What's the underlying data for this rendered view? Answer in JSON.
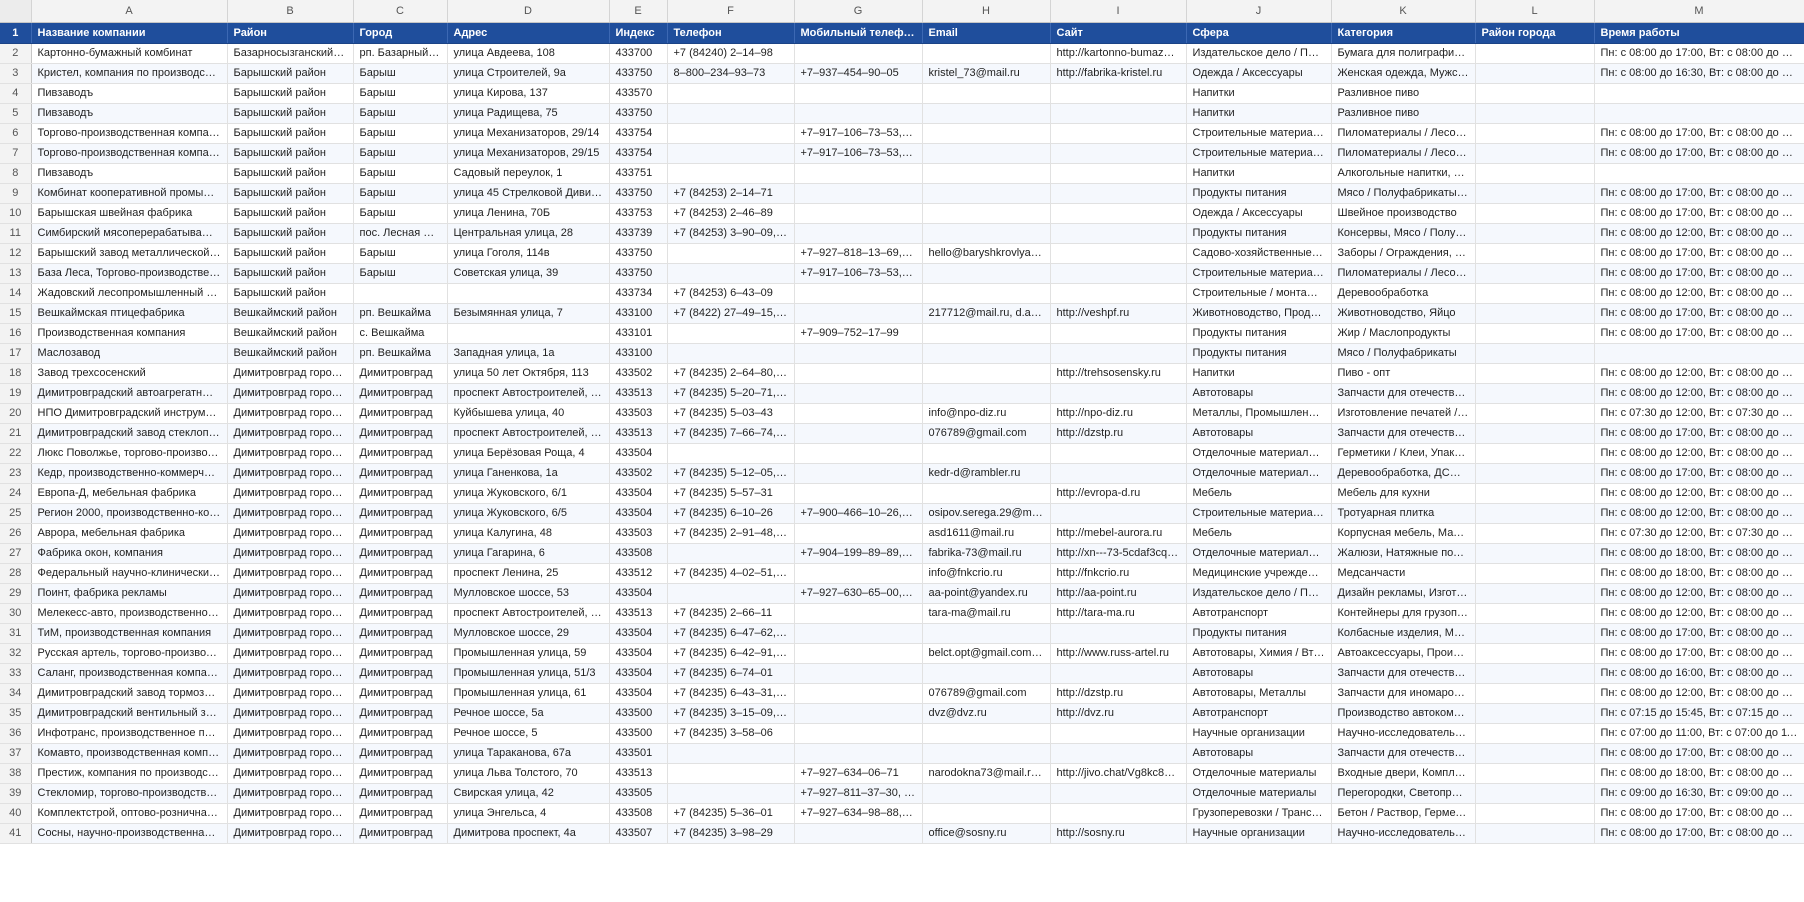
{
  "column_letters": [
    "A",
    "B",
    "C",
    "D",
    "E",
    "F",
    "G",
    "H",
    "I",
    "J",
    "K",
    "L",
    "M"
  ],
  "header": {
    "row_number": "1",
    "cells": [
      "Название компании",
      "Район",
      "Город",
      "Адрес",
      "Индекс",
      "Телефон",
      "Мобильный телефон",
      "Email",
      "Сайт",
      "Сфера",
      "Категория",
      "Район города",
      "Время работы"
    ]
  },
  "rows": [
    {
      "num": "2",
      "cells": [
        "Картонно-бумажный комбинат",
        "Базарносызганский ра...",
        "рп. Базарный С...",
        "улица Авдеева, 108",
        "433700",
        "+7 (84240) 2–14–98",
        "",
        "",
        "http://kartonno-bumazhn...",
        "Издательское дело / Поли...",
        "Бумага для полиграфии, Б...",
        "",
        "Пн: с 08:00 до 17:00, Вт: с 08:00 до 17:00, С..."
      ]
    },
    {
      "num": "3",
      "cells": [
        "Кристел, компания по производству ...",
        "Барышский район",
        "Барыш",
        "улица Строителей, 9а",
        "433750",
        "8–800–234–93–73",
        "+7–937–454–90–05",
        "kristel_73@mail.ru",
        "http://fabrika-kristel.ru",
        "Одежда / Аксессуары",
        "Женская одежда, Мужская...",
        "",
        "Пн: с 08:00 до 16:30, Вт: с 08:00 до 16:30, С..."
      ]
    },
    {
      "num": "4",
      "cells": [
        "Пивзаводъ",
        "Барышский район",
        "Барыш",
        "улица Кирова, 137",
        "433570",
        "",
        "",
        "",
        "",
        "Напитки",
        "Разливное пиво",
        "",
        ""
      ]
    },
    {
      "num": "5",
      "cells": [
        "Пивзаводъ",
        "Барышский район",
        "Барыш",
        "улица Радищева, 75",
        "433750",
        "",
        "",
        "",
        "",
        "Напитки",
        "Разливное пиво",
        "",
        ""
      ]
    },
    {
      "num": "6",
      "cells": [
        "Торгово-производственная компания",
        "Барышский район",
        "Барыш",
        "улица Механизаторов, 29/14",
        "433754",
        "",
        "+7–917–106–73–53, +7...",
        "",
        "",
        "Строительные материалы ...",
        "Пиломатериалы / Лесомат...",
        "",
        "Пн: с 08:00 до 17:00, Вт: с 08:00 до 17:00, С..."
      ]
    },
    {
      "num": "7",
      "cells": [
        "Торгово-производственная компания",
        "Барышский район",
        "Барыш",
        "улица Механизаторов, 29/15",
        "433754",
        "",
        "+7–917–106–73–53, +7...",
        "",
        "",
        "Строительные материалы ...",
        "Пиломатериалы / Лесомат...",
        "",
        "Пн: с 08:00 до 17:00, Вт: с 08:00 до 17:00, С..."
      ]
    },
    {
      "num": "8",
      "cells": [
        "Пивзаводъ",
        "Барышский район",
        "Барыш",
        "Садовый переулок, 1",
        "433751",
        "",
        "",
        "",
        "",
        "Напитки",
        "Алкогольные напитки, Раз...",
        "",
        ""
      ]
    },
    {
      "num": "9",
      "cells": [
        "Комбинат кооперативной промышле...",
        "Барышский район",
        "Барыш",
        "улица 45 Стрелковой Дивизии...",
        "433750",
        "+7 (84253) 2–14–71",
        "",
        "",
        "",
        "Продукты питания",
        "Мясо / Полуфабрикаты, Хл...",
        "",
        "Пн: с 08:00 до 17:00, Вт: с 08:00 до 17:00, С..."
      ]
    },
    {
      "num": "10",
      "cells": [
        "Барышская швейная фабрика",
        "Барышский район",
        "Барыш",
        "улица Ленина, 70Б",
        "433753",
        "+7 (84253) 2–46–89",
        "",
        "",
        "",
        "Одежда / Аксессуары",
        "Швейное производство",
        "",
        "Пн: с 08:00 до 17:00, Вт: с 08:00 до 17:00, С..."
      ]
    },
    {
      "num": "11",
      "cells": [
        "Симбирский мясоперерабатывающи...",
        "Барышский район",
        "пос. Лесная Дача",
        "Центральная улица, 28",
        "433739",
        "+7 (84253) 3–90–09, +7...",
        "",
        "",
        "",
        "Продукты питания",
        "Консервы, Мясо / Полуфа...",
        "",
        "Пн: с 08:00 до 12:00, Вт: с 08:00 до 12:00, С..."
      ]
    },
    {
      "num": "12",
      "cells": [
        "Барышский завод металлической кро...",
        "Барышский район",
        "Барыш",
        "улица Гоголя, 114в",
        "433750",
        "",
        "+7–927–818–13–69, +7...",
        "hello@baryshkrovlya.ru",
        "",
        "Садово-хозяйственные то...",
        "Заборы / Ограждения, Кр...",
        "",
        "Пн: с 08:00 до 17:00, Вт: с 08:00 до 17:00, С..."
      ]
    },
    {
      "num": "13",
      "cells": [
        "База Леса, Торгово-производственна...",
        "Барышский район",
        "Барыш",
        "Советская улица, 39",
        "433750",
        "",
        "+7–917–106–73–53, +7...",
        "",
        "",
        "Строительные материалы ...",
        "Пиломатериалы / Лесомат...",
        "",
        "Пн: с 08:00 до 17:00, Вт: с 08:00 до 17:00, С..."
      ]
    },
    {
      "num": "14",
      "cells": [
        "Жадовский лесопромышленный ком...",
        "Барышский район",
        "",
        "",
        "433734",
        "+7 (84253) 6–43–09",
        "",
        "",
        "",
        "Строительные / монтажны...",
        "Деревообработка",
        "",
        "Пн: с 08:00 до 12:00, Вт: с 08:00 до 12:00, С..."
      ]
    },
    {
      "num": "15",
      "cells": [
        "Вешкаймская птицефабрика",
        "Вешкаймский район",
        "рп. Вешкайма",
        "Безымянная улица, 7",
        "433100",
        "+7 (8422) 27–49–15, +7...",
        "",
        "217712@mail.ru, d.anal...",
        "http://veshpf.ru",
        "Животноводство, Продукт...",
        "Животноводство, Яйцо",
        "",
        "Пн: с 08:00 до 17:00, Вт: с 08:00 до 17:00, С..."
      ]
    },
    {
      "num": "16",
      "cells": [
        "Производственная компания",
        "Вешкаймский район",
        "с. Вешкайма",
        "",
        "433101",
        "",
        "+7–909–752–17–99",
        "",
        "",
        "Продукты питания",
        "Жир / Маслопродукты",
        "",
        "Пн: с 08:00 до 17:00, Вт: с 08:00 до 17:00, С..."
      ]
    },
    {
      "num": "17",
      "cells": [
        "Маслозавод",
        "Вешкаймский район",
        "рп. Вешкайма",
        "Западная улица, 1а",
        "433100",
        "",
        "",
        "",
        "",
        "Продукты питания",
        "Мясо / Полуфабрикаты",
        "",
        ""
      ]
    },
    {
      "num": "18",
      "cells": [
        "Завод трехсосенский",
        "Димитровград городск...",
        "Димитровград",
        "улица 50 лет Октября, 113",
        "433502",
        "+7 (84235) 2–64–80, +7...",
        "",
        "",
        "http://trehsosensky.ru",
        "Напитки",
        "Пиво - опт",
        "",
        "Пн: с 08:00 до 12:00, Вт: с 08:00 до 12:00, С..."
      ]
    },
    {
      "num": "19",
      "cells": [
        "Димитровградский автоагрегатный з...",
        "Димитровград городск...",
        "Димитровград",
        "проспект Автостроителей, 78",
        "433513",
        "+7 (84235) 5–20–71, +7...",
        "",
        "",
        "",
        "Автотовары",
        "Запчасти для отечественн...",
        "",
        "Пн: с 08:00 до 12:00, Вт: с 08:00 до 12:00, С..."
      ]
    },
    {
      "num": "20",
      "cells": [
        "НПО Димитровградский инструмента...",
        "Димитровград городск...",
        "Димитровград",
        "Куйбышева улица, 40",
        "433503",
        "+7 (84235) 5–03–43",
        "",
        "info@npo-diz.ru",
        "http://npo-diz.ru",
        "Металлы, Промышленное ...",
        "Изготовление печатей / ш...",
        "",
        "Пн: с 07:30 до 12:00, Вт: с 07:30 до 12:00, С..."
      ]
    },
    {
      "num": "21",
      "cells": [
        "Димитровградский завод стеклоподъ...",
        "Димитровград городск...",
        "Димитровград",
        "проспект Автостроителей, 83",
        "433513",
        "+7 (84235) 7–66–74, +7...",
        "",
        "076789@gmail.com",
        "http://dzstp.ru",
        "Автотовары",
        "Запчасти для отечественн...",
        "",
        "Пн: с 08:00 до 17:00, Вт: с 08:00 до 17:00, С..."
      ]
    },
    {
      "num": "22",
      "cells": [
        "Люкс Поволжье, торгово-производст...",
        "Димитровград городск...",
        "Димитровград",
        "улица Берёзовая Роща, 4",
        "433504",
        "",
        "",
        "",
        "",
        "Отделочные материалы, Т...",
        "Герметики / Клеи, Упаково...",
        "",
        "Пн: с 08:00 до 12:00, Вт: с 08:00 до 12:00, С..."
      ]
    },
    {
      "num": "23",
      "cells": [
        "Кедр, производственно-коммерческа...",
        "Димитровград городск...",
        "Димитровград",
        "улица Ганенкова, 1а",
        "433502",
        "+7 (84235) 5–12–05, +7...",
        "",
        "kedr-d@rambler.ru",
        "",
        "Отделочные материалы, С...",
        "Деревообработка, ДСП / ...",
        "",
        "Пн: с 08:00 до 17:00, Вт: с 08:00 до 17:00, С..."
      ]
    },
    {
      "num": "24",
      "cells": [
        "Европа-Д, мебельная фабрика",
        "Димитровград городск...",
        "Димитровград",
        "улица Жуковского, 6/1",
        "433504",
        "+7 (84235) 5–57–31",
        "",
        "",
        "http://evropa-d.ru",
        "Мебель",
        "Мебель для кухни",
        "",
        "Пн: с 08:00 до 12:00, Вт: с 08:00 до 12:00, С..."
      ]
    },
    {
      "num": "25",
      "cells": [
        "Регион 2000, производственно-комм...",
        "Димитровград городск...",
        "Димитровград",
        "улица Жуковского, 6/5",
        "433504",
        "+7 (84235) 6–10–26",
        "+7–900–466–10–26, +7...",
        "osipov.serega.29@mail.ru",
        "",
        "Строительные материалы ...",
        "Тротуарная плитка",
        "",
        "Пн: с 08:00 до 12:00, Вт: с 08:00 до 12:00, С..."
      ]
    },
    {
      "num": "26",
      "cells": [
        "Аврора, мебельная фабрика",
        "Димитровград городск...",
        "Димитровград",
        "улица Калугина, 48",
        "433503",
        "+7 (84235) 2–91–48, +7...",
        "",
        "asd1611@mail.ru",
        "http://mebel-aurora.ru",
        "Мебель",
        "Корпусная мебель, Матрас...",
        "",
        "Пн: с 07:30 до 12:00, Вт: с 07:30 до 12:00, С..."
      ]
    },
    {
      "num": "27",
      "cells": [
        "Фабрика окон, компания",
        "Димитровград городск...",
        "Димитровград",
        "улица Гагарина, 6",
        "433508",
        "",
        "+7–904–199–89–89, +7...",
        "fabrika-73@mail.ru",
        "http://xn---73-5cdaf3cqc4...",
        "Отделочные материалы, П...",
        "Жалюзи, Натяжные потол...",
        "",
        "Пн: с 08:00 до 18:00, Вт: с 08:00 до 18:00, С..."
      ]
    },
    {
      "num": "28",
      "cells": [
        "Федеральный научно-клинический ц...",
        "Димитровград городск...",
        "Димитровград",
        "проспект Ленина, 25",
        "433512",
        "+7 (84235) 4–02–51, +7...",
        "",
        "info@fnkcrio.ru",
        "http://fnkcrio.ru",
        "Медицинские учреждения",
        "Медсанчасти",
        "",
        "Пн: с 08:00 до 18:00, Вт: с 08:00 до 18:00, С..."
      ]
    },
    {
      "num": "29",
      "cells": [
        "Поинт, фабрика рекламы",
        "Димитровград городск...",
        "Димитровград",
        "Мулловское шоссе, 53",
        "433504",
        "",
        "+7–927–630–65–00, +7...",
        "aa-point@yandex.ru",
        "http://aa-point.ru",
        "Издательское дело / Поли...",
        "Дизайн рекламы, Изготов...",
        "",
        "Пн: с 08:00 до 12:00, Вт: с 08:00 до 12:00, С..."
      ]
    },
    {
      "num": "30",
      "cells": [
        "Мелекесс-авто, производственно-скл...",
        "Димитровград городск...",
        "Димитровград",
        "проспект Автостроителей, 91/...",
        "433513",
        "+7 (84235) 2–66–11",
        "",
        "tara-ma@mail.ru",
        "http://tara-ma.ru",
        "Автотранспорт",
        "Контейнеры для грузопер...",
        "",
        "Пн: с 08:00 до 12:00, Вт: с 08:00 до 12:00, С..."
      ]
    },
    {
      "num": "31",
      "cells": [
        "ТиМ, производственная компания",
        "Димитровград городск...",
        "Димитровград",
        "Мулловское шоссе, 29",
        "433504",
        "+7 (84235) 6–47–62, +7...",
        "",
        "",
        "",
        "Продукты питания",
        "Колбасные изделия, Мясо ...",
        "",
        "Пн: с 08:00 до 17:00, Вт: с 08:00 до 17:00, С..."
      ]
    },
    {
      "num": "32",
      "cells": [
        "Русская артель, торгово-производств...",
        "Димитровград городск...",
        "Димитровград",
        "Промышленная улица, 59",
        "433504",
        "+7 (84235) 6–42–91, 8–...",
        "",
        "belct.opt@gmail.com, b...",
        "http://www.russ-artel.ru",
        "Автотовары, Химия / Втор...",
        "Автоаксессуары, Произво...",
        "",
        "Пн: с 08:00 до 17:00, Вт: с 08:00 до 17:00, С..."
      ]
    },
    {
      "num": "33",
      "cells": [
        "Саланг, производственная компания",
        "Димитровград городск...",
        "Димитровград",
        "Промышленная улица, 51/3",
        "433504",
        "+7 (84235) 6–74–01",
        "",
        "",
        "",
        "Автотовары",
        "Запчасти для отечественн...",
        "",
        "Пн: с 08:00 до 16:00, Вт: с 08:00 до 16:00, С..."
      ]
    },
    {
      "num": "34",
      "cells": [
        "Димитровградский завод тормозной ...",
        "Димитровград городск...",
        "Димитровград",
        "Промышленная улица, 61",
        "433504",
        "+7 (84235) 6–43–31, +7...",
        "",
        "076789@gmail.com",
        "http://dzstp.ru",
        "Автотовары, Металлы",
        "Запчасти для иномарок, З...",
        "",
        "Пн: с 08:00 до 12:00, Вт: с 08:00 до 12:00, С..."
      ]
    },
    {
      "num": "35",
      "cells": [
        "Димитровградский вентильный завод",
        "Димитровград городск...",
        "Димитровград",
        "Речное шоссе, 5а",
        "433500",
        "+7 (84235) 3–15–09, +7...",
        "",
        "dvz@dvz.ru",
        "http://dvz.ru",
        "Автотранспорт",
        "Производство автокомпле...",
        "",
        "Пн: с 07:15 до 15:45, Вт: с 07:15 до 15:45, С..."
      ]
    },
    {
      "num": "36",
      "cells": [
        "Инфотранс, производственное подра...",
        "Димитровград городск...",
        "Димитровград",
        "Речное шоссе, 5",
        "433500",
        "+7 (84235) 3–58–06",
        "",
        "",
        "",
        "Научные организации",
        "Научно-исследовательски...",
        "",
        "Пн: с 07:00 до 11:00, Вт: с 07:00 до 11:00, С..."
      ]
    },
    {
      "num": "37",
      "cells": [
        "Комавто, производственная компания",
        "Димитровград городск...",
        "Димитровград",
        "улица Тараканова, 67а",
        "433501",
        "",
        "",
        "",
        "",
        "Автотовары",
        "Запчасти для отечественн...",
        "",
        "Пн: с 08:00 до 17:00, Вт: с 08:00 до 17:00, С..."
      ]
    },
    {
      "num": "38",
      "cells": [
        "Престиж, компания по производству ...",
        "Димитровград городск...",
        "Димитровград",
        "улица Льва Толстого, 70",
        "433513",
        "",
        "+7–927–634–06–71",
        "narodokna73@mail.ru, ...",
        "http://jivo.chat/Vg8kc8bs...",
        "Отделочные материалы",
        "Входные двери, Комплект...",
        "",
        "Пн: с 08:00 до 18:00, Вт: с 08:00 до 18:00, С..."
      ]
    },
    {
      "num": "39",
      "cells": [
        "Стекломир, торгово-производственн...",
        "Димитровград городск...",
        "Димитровград",
        "Свирская улица, 42",
        "433505",
        "",
        "+7–927–811–37–30, +7...",
        "",
        "",
        "Отделочные материалы",
        "Перегородки, Светопрозр...",
        "",
        "Пн: с 09:00 до 16:30, Вт: с 09:00 до 16:30, С..."
      ]
    },
    {
      "num": "40",
      "cells": [
        "Комплектстрой, оптово-розничная ф...",
        "Димитровград городск...",
        "Димитровград",
        "улица Энгельса, 4",
        "433508",
        "+7 (84235) 5–36–01",
        "+7–927–634–98–88, +7...",
        "",
        "",
        "Грузоперевозки / Трансло...",
        "Бетон / Раствор, Герметик...",
        "",
        "Пн: с 08:00 до 17:00, Вт: с 08:00 до 17:00, С..."
      ]
    },
    {
      "num": "41",
      "cells": [
        "Сосны, научно-производственная фи...",
        "Димитровград городск...",
        "Димитровград",
        "Димитрова проспект, 4а",
        "433507",
        "+7 (84235) 3–98–29",
        "",
        "office@sosny.ru",
        "http://sosny.ru",
        "Научные организации",
        "Научно-исследовательски...",
        "",
        "Пн: с 08:00 до 17:00, Вт: с 08:00 до 17:00, С..."
      ]
    }
  ],
  "colors": {
    "header_bg": "#1f4e9c",
    "header_text": "#ffffff",
    "stripe_bg": "#f5f8fd",
    "gridline": "#e1e1e1",
    "letter_bar_bg": "#f3f3f3"
  }
}
